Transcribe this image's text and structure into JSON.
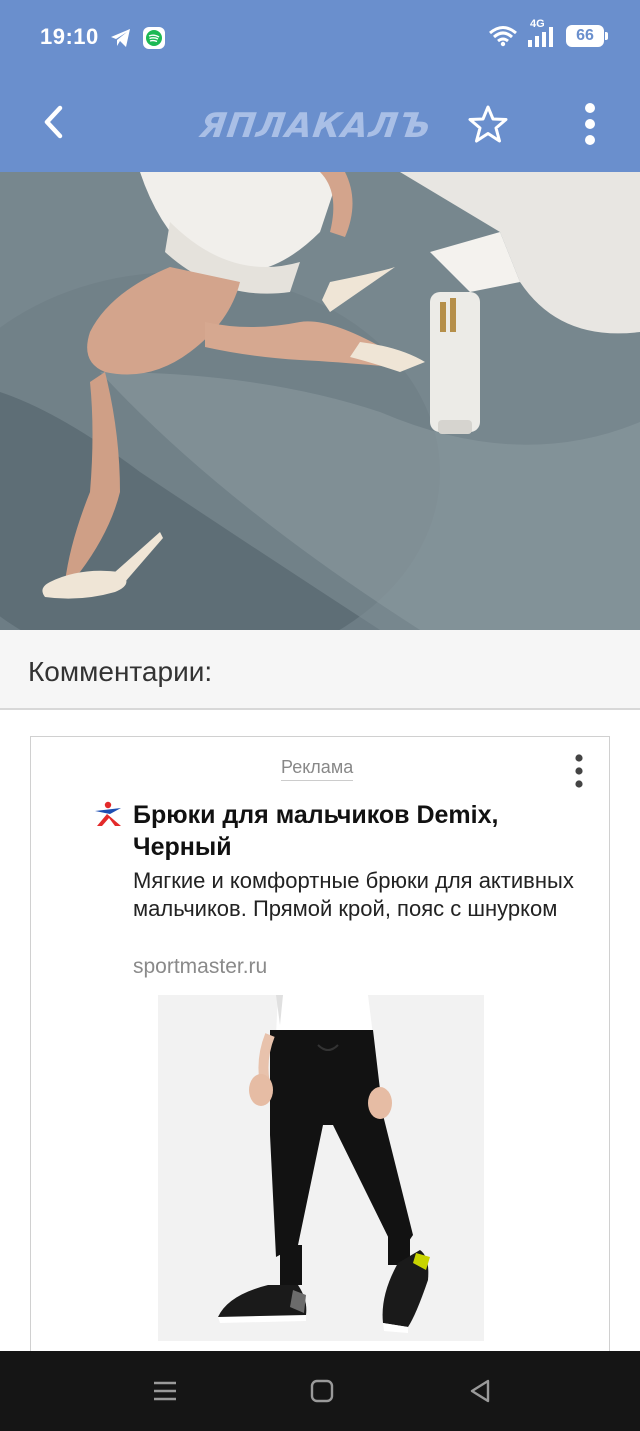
{
  "status_bar": {
    "time": "19:10",
    "network": "4G",
    "battery": "66",
    "icons": [
      "telegram-icon",
      "spotify-icon",
      "wifi-icon",
      "signal-icon",
      "battery-icon"
    ]
  },
  "app_bar": {
    "logo_text": "ЯПЛАКАЛЪ",
    "back_icon": "chevron-left-icon",
    "favorite_icon": "star-outline-icon",
    "menu_icon": "more-vertical-icon",
    "color": "#6a8fcd"
  },
  "comments": {
    "title": "Комментарии:"
  },
  "ad": {
    "label": "Реклама",
    "title": "Брюки для мальчиков Demix, Черный",
    "description": "Мягкие и комфортные брюки для активных мальчиков. Прямой крой, пояс с шнурком",
    "domain": "sportmaster.ru",
    "menu_icon": "more-vertical-icon",
    "favicon": "sportmaster-logo-icon"
  },
  "nav_bar": {
    "items": [
      "recents-icon",
      "home-icon",
      "back-triangle-icon"
    ]
  }
}
